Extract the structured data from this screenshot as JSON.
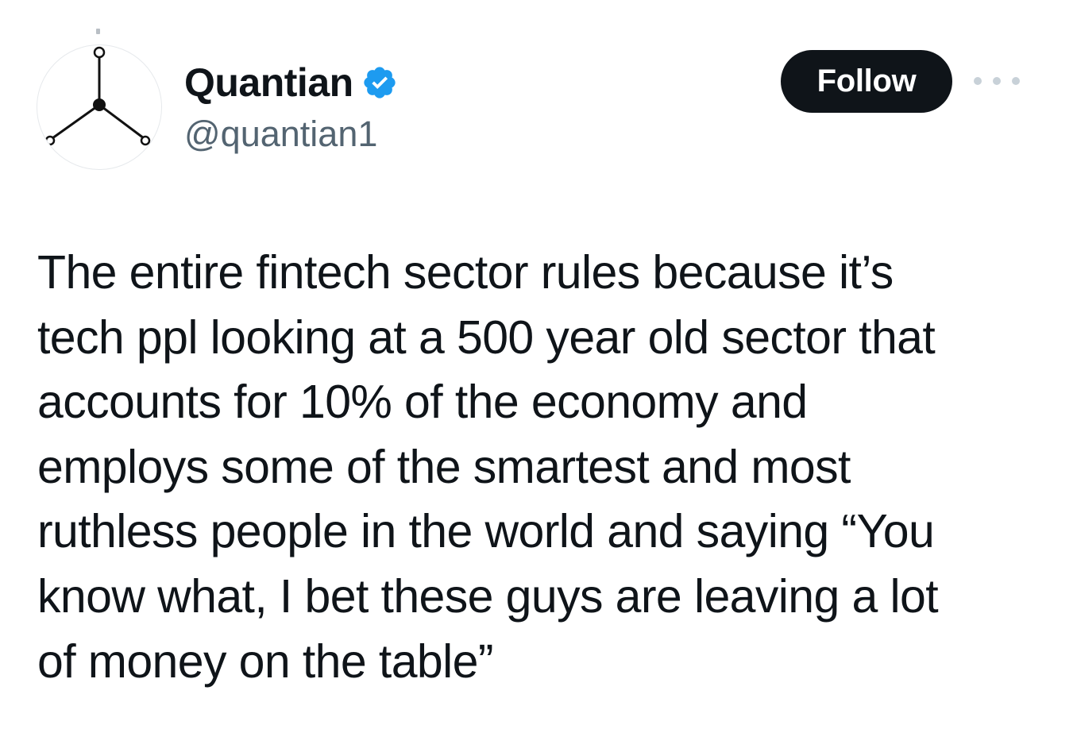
{
  "author": {
    "display_name": "Quantian",
    "handle": "@quantian1",
    "verified": true,
    "verified_color": "#1d9bf0",
    "avatar_icon": "node-graph-icon"
  },
  "actions": {
    "follow_label": "Follow",
    "follow_bg": "#0f1419",
    "more_icon": "more-horizontal-icon"
  },
  "tweet": {
    "lines": [
      "The entire fintech sector rules because it’s",
      "tech ppl looking at a 500 year old sector that",
      "accounts for 10% of the economy and",
      "employs some of the smartest and most",
      "ruthless people in the world and saying “You",
      "know what, I bet these guys are leaving a lot",
      "of money on the table”"
    ]
  }
}
